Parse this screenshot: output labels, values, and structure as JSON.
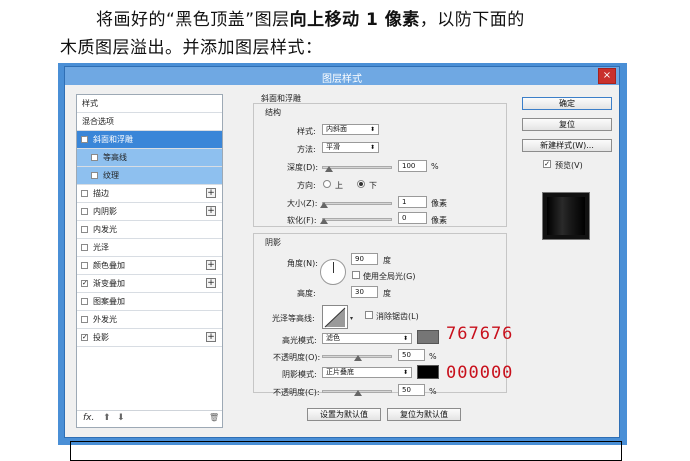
{
  "caption": {
    "part1": "将画好的“黑色顶盖”图层",
    "bold": "向上移动 1 像素",
    "part2": "，以防下面的",
    "line2": "木质图层溢出。并添加图层样式："
  },
  "dialog": {
    "title": "图层样式",
    "close": "×",
    "styles_list": [
      {
        "label": "样式"
      },
      {
        "label": "混合选项"
      },
      {
        "label": "斜面和浮雕",
        "checked": "✓"
      },
      {
        "label": "等高线"
      },
      {
        "label": "纹理"
      },
      {
        "label": "描边",
        "plus": "+"
      },
      {
        "label": "内阴影",
        "plus": "+"
      },
      {
        "label": "内发光"
      },
      {
        "label": "光泽"
      },
      {
        "label": "颜色叠加",
        "plus": "+"
      },
      {
        "label": "渐变叠加",
        "checked": "✓",
        "plus": "+"
      },
      {
        "label": "图案叠加"
      },
      {
        "label": "外发光"
      },
      {
        "label": "投影",
        "checked": "✓",
        "plus": "+"
      }
    ],
    "footer": {
      "fx": "fx.",
      "up": "⬆",
      "down": "⬇",
      "trash": "🗑"
    },
    "bevel": {
      "section": "斜面和浮雕",
      "structure": "结构",
      "style_label": "样式:",
      "style_value": "内斜面",
      "technique_label": "方法:",
      "technique_value": "平滑",
      "depth_label": "深度(D):",
      "depth_value": "100",
      "percent": "%",
      "direction_label": "方向:",
      "dir_up": "上",
      "dir_down": "下",
      "size_label": "大小(Z):",
      "size_value": "1",
      "px": "像素",
      "soften_label": "软化(F):",
      "soften_value": "0",
      "depth_pct": 0.08
    },
    "shading": {
      "section": "阴影",
      "angle_label": "角度(N):",
      "angle_value": "90",
      "deg": "度",
      "global_light": "使用全局光(G)",
      "altitude_label": "高度:",
      "altitude_value": "30",
      "gloss_label": "光泽等高线:",
      "antialias": "消除锯齿(L)",
      "highlight_label": "高光模式:",
      "highlight_mode": "滤色",
      "highlight_color": "#767676",
      "hl_opacity_label": "不透明度(O):",
      "hl_opacity_value": "50",
      "shadow_label": "阴影模式:",
      "shadow_mode": "正片叠底",
      "shadow_color": "#000000",
      "sh_opacity_label": "不透明度(C):",
      "sh_opacity_value": "50",
      "hl_opacity_pct": 0.5,
      "sh_opacity_pct": 0.5
    },
    "buttons": {
      "make_default": "设置为默认值",
      "reset_default": "复位为默认值",
      "ok": "确定",
      "reset": "复位",
      "new_style": "新建样式(W)...",
      "preview": "预览(V)"
    }
  },
  "annotations": {
    "highlight_hex": "767676",
    "shadow_hex": "000000"
  }
}
